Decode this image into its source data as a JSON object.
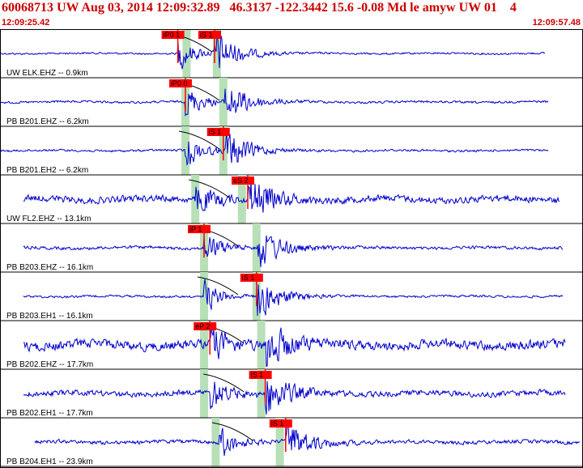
{
  "header": {
    "title": "60068713 UW Aug 03, 2014 12:09:32.89   46.3137 -122.3442 15.6 -0.08 Md le amyw UW 01    4",
    "start_time": "12:09:25.42",
    "end_time": "12:09:57.48"
  },
  "colors": {
    "trace": "#0000cc",
    "pick": "#ff0000",
    "window": "#b8e0b8",
    "divider": "#000000",
    "curve": "#000000"
  },
  "traces": [
    {
      "label": "UW ELK.EHZ -- 0.9km",
      "amp": 0.15,
      "data_start": 0.0,
      "data_end": 0.935,
      "p_time": 0.305,
      "s_time": 0.368,
      "picks": [
        {
          "text": "iP0 1",
          "t": 0.305
        },
        {
          "text": "iS 1",
          "t": 0.368
        }
      ],
      "windows": [
        0.32,
        0.372
      ]
    },
    {
      "label": "PB B201.EHZ -- 6.2km",
      "amp": 0.18,
      "data_start": 0.0,
      "data_end": 0.94,
      "p_time": 0.318,
      "s_time": 0.385,
      "picks": [
        {
          "text": "iP0 0",
          "t": 0.318
        }
      ],
      "windows": [
        0.318,
        0.383
      ]
    },
    {
      "label": "PB B201.EH2 -- 6.2km",
      "amp": 0.18,
      "data_start": 0.0,
      "data_end": 0.94,
      "p_time": 0.318,
      "s_time": 0.385,
      "picks": [
        {
          "text": "iS 1",
          "t": 0.383
        }
      ],
      "windows": [
        0.318,
        0.383
      ]
    },
    {
      "label": "UW FL2.EHZ -- 13.1km",
      "amp": 0.55,
      "data_start": 0.04,
      "data_end": 0.96,
      "p_time": 0.335,
      "s_time": 0.425,
      "picks": [
        {
          "text": "eS 2",
          "t": 0.425
        }
      ],
      "windows": [
        0.335,
        0.415
      ]
    },
    {
      "label": "PB B203.EHZ -- 16.1km",
      "amp": 0.25,
      "data_start": 0.04,
      "data_end": 0.965,
      "p_time": 0.35,
      "s_time": 0.44,
      "picks": [
        {
          "text": "iP 1",
          "t": 0.35
        }
      ],
      "windows": [
        0.35,
        0.44
      ]
    },
    {
      "label": "PB B203.EH1 -- 16.1km",
      "amp": 0.18,
      "data_start": 0.04,
      "data_end": 0.965,
      "p_time": 0.35,
      "s_time": 0.44,
      "picks": [
        {
          "text": "iS 1",
          "t": 0.44
        }
      ],
      "windows": [
        0.35,
        0.44
      ]
    },
    {
      "label": "PB B202.EHZ -- 17.7km",
      "amp": 0.75,
      "data_start": 0.04,
      "data_end": 0.97,
      "p_time": 0.36,
      "s_time": 0.455,
      "picks": [
        {
          "text": "eP 2",
          "t": 0.36
        }
      ],
      "windows": [
        0.35,
        0.448
      ]
    },
    {
      "label": "PB B202.EH1 -- 17.7km",
      "amp": 0.45,
      "data_start": 0.04,
      "data_end": 0.97,
      "p_time": 0.36,
      "s_time": 0.455,
      "picks": [
        {
          "text": "iS 1",
          "t": 0.455
        }
      ],
      "windows": [
        0.35,
        0.448
      ]
    },
    {
      "label": "PB B204.EH1 -- 23.9km",
      "amp": 0.3,
      "data_start": 0.06,
      "data_end": 0.995,
      "p_time": 0.375,
      "s_time": 0.49,
      "picks": [
        {
          "text": "iS 1",
          "t": 0.49
        }
      ],
      "windows": [
        0.37,
        0.48
      ]
    }
  ]
}
